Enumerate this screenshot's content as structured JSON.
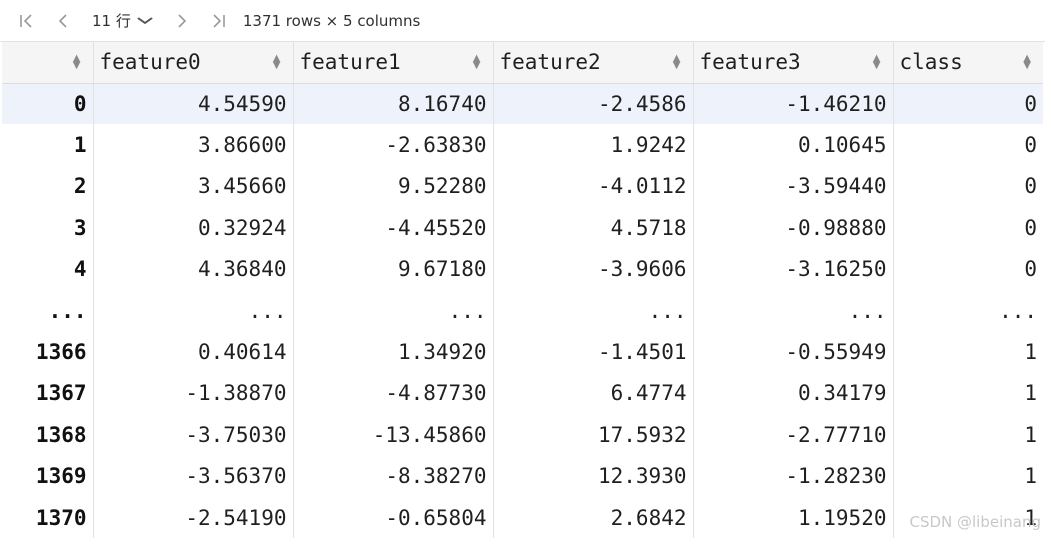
{
  "toolbar": {
    "first_icon": "first-page-icon",
    "prev_icon": "chevron-left-icon",
    "row_count_label": "11 行",
    "next_icon": "chevron-right-icon",
    "last_icon": "last-page-icon",
    "summary": "1371 rows × 5 columns"
  },
  "table": {
    "columns": [
      "",
      "feature0",
      "feature1",
      "feature2",
      "feature3",
      "class"
    ],
    "rows": [
      [
        "0",
        "4.54590",
        "8.16740",
        "-2.4586",
        "-1.46210",
        "0"
      ],
      [
        "1",
        "3.86600",
        "-2.63830",
        "1.9242",
        "0.10645",
        "0"
      ],
      [
        "2",
        "3.45660",
        "9.52280",
        "-4.0112",
        "-3.59440",
        "0"
      ],
      [
        "3",
        "0.32924",
        "-4.45520",
        "4.5718",
        "-0.98880",
        "0"
      ],
      [
        "4",
        "4.36840",
        "9.67180",
        "-3.9606",
        "-3.16250",
        "0"
      ],
      [
        "...",
        "...",
        "...",
        "...",
        "...",
        "..."
      ],
      [
        "1366",
        "0.40614",
        "1.34920",
        "-1.4501",
        "-0.55949",
        "1"
      ],
      [
        "1367",
        "-1.38870",
        "-4.87730",
        "6.4774",
        "0.34179",
        "1"
      ],
      [
        "1368",
        "-3.75030",
        "-13.45860",
        "17.5932",
        "-2.77710",
        "1"
      ],
      [
        "1369",
        "-3.56370",
        "-8.38270",
        "12.3930",
        "-1.28230",
        "1"
      ],
      [
        "1370",
        "-2.54190",
        "-0.65804",
        "2.6842",
        "1.19520",
        "1"
      ]
    ],
    "selected_row": 0
  },
  "watermark": "CSDN @libeinang",
  "colors": {
    "header_bg": "#f5f5f5",
    "selected_row_bg": "#eef3fb",
    "grid_line": "#e2e2e2"
  }
}
